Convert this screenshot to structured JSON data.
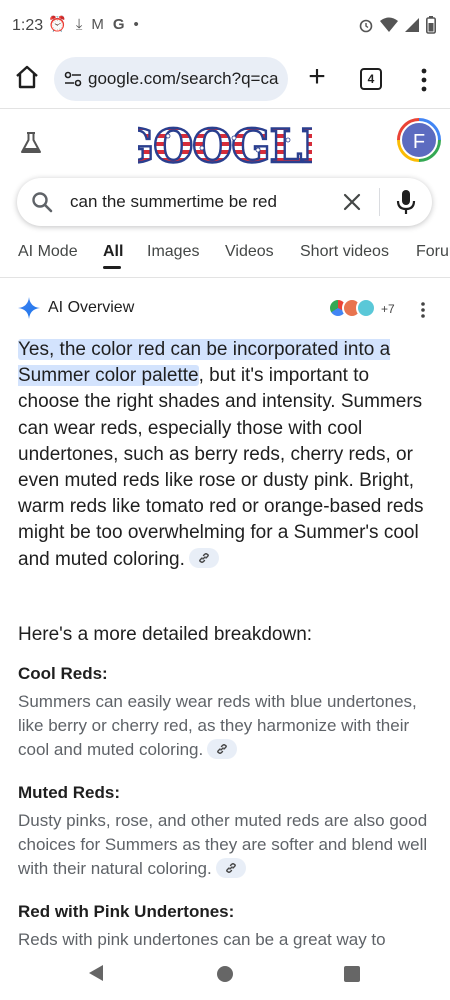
{
  "status_bar": {
    "time": "1:23",
    "left_icons": [
      "alarm-icon",
      "download-done-icon",
      "gmail-icon",
      "google-icon",
      "dot-icon"
    ],
    "left_glyphs": [
      "⏰",
      "⤓",
      "M",
      "G",
      "•"
    ],
    "right_icons": [
      "alarm-icon",
      "wifi-icon",
      "signal-icon",
      "battery-icon"
    ]
  },
  "browser": {
    "url": "google.com/search?q=ca",
    "tab_count": "4"
  },
  "google": {
    "logo_text": "GOOGLE",
    "avatar_letter": "F"
  },
  "search": {
    "query": "can the summertime be red"
  },
  "tabs": [
    {
      "label": "AI Mode",
      "active": false
    },
    {
      "label": "All",
      "active": true
    },
    {
      "label": "Images",
      "active": false
    },
    {
      "label": "Videos",
      "active": false
    },
    {
      "label": "Short videos",
      "active": false
    },
    {
      "label": "Forum",
      "active": false
    }
  ],
  "ai_overview": {
    "title": "AI Overview",
    "sources_more": "+7",
    "highlight": "Yes, the color red can be incorporated into a Summer color palette",
    "body": ", but it's important to choose the right shades and intensity. Summers can wear reds, especially those with cool undertones, such as berry reds, cherry reds, or even muted reds like rose or dusty pink. Bright, warm reds like tomato red or orange-based reds might be too overwhelming for a Summer's cool and muted coloring.",
    "breakdown_heading": "Here's a more detailed breakdown:",
    "sections": [
      {
        "heading": "Cool Reds:",
        "text": "Summers can easily wear reds with blue undertones, like berry or cherry red, as they harmonize with their cool and muted coloring."
      },
      {
        "heading": "Muted Reds:",
        "text": "Dusty pinks, rose, and other muted reds are also good choices for Summers as they are softer and blend well with their natural coloring."
      },
      {
        "heading": "Red with Pink Undertones:",
        "text": "Reds with pink undertones can be a great way to"
      }
    ]
  },
  "colors": {
    "highlight": "#d3e3fd",
    "accent_blue": "#4285f4",
    "logo_red": "#d62d3a",
    "logo_blue": "#2a3f8f"
  }
}
